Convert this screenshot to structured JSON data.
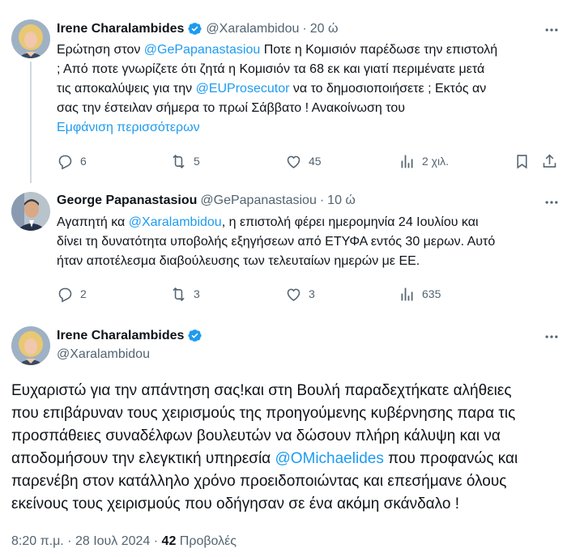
{
  "tweets": [
    {
      "author": "Irene Charalambides",
      "handle": "@Xaralambidou",
      "time": "20 ώ",
      "text_lines": [
        [
          {
            "t": "Ερώτηση στον "
          },
          {
            "t": "@GePapanastasiou",
            "m": true
          },
          {
            "t": " Ποτε η Κομισιόν παρέδωσε την επιστολή"
          }
        ],
        [
          {
            "t": "; Από ποτε γνωρίζετε ότι ζητά η Κομισιόν τα 68 εκ και γιατί περιμένατε μετά"
          }
        ],
        [
          {
            "t": "τις αποκαλύψεις για την "
          },
          {
            "t": "@EUProsecutor",
            "m": true
          },
          {
            "t": " να το δημοσιοποιήσετε ; Εκτός αν"
          }
        ],
        [
          {
            "t": "σας την έστειλαν σήμερα το πρωί Σάββατο ! Ανακοίνωση του"
          }
        ]
      ],
      "show_more": "Εμφάνιση περισσότερων",
      "replies": "6",
      "reposts": "5",
      "likes": "45",
      "views": "2 χιλ."
    },
    {
      "author": "George Papanastasiou",
      "handle": "@GePapanastasiou",
      "time": "10 ώ",
      "text_lines": [
        [
          {
            "t": "Αγαπητή κα "
          },
          {
            "t": "@Xaralambidou",
            "m": true
          },
          {
            "t": ", η επιστολή φέρει ημερομηνία 24 Ιουλίου και"
          }
        ],
        [
          {
            "t": "δίνει τη δυνατότητα υποβολής εξηγήσεων από ΕΤΥΦΑ εντός 30 μερων. Αυτό"
          }
        ],
        [
          {
            "t": "ήταν αποτέλεσμα διαβούλευσης των τελευταίων ημερών με ΕΕ."
          }
        ]
      ],
      "replies": "2",
      "reposts": "3",
      "likes": "3",
      "views": "635"
    }
  ],
  "main": {
    "author": "Irene Charalambides",
    "handle": "@Xaralambidou",
    "text_lines": [
      [
        {
          "t": "Ευχαριστώ για την απάντηση σας!και στη Βουλή παραδεχτήκατε αλήθειες"
        }
      ],
      [
        {
          "t": "που επιβάρυναν τους χειρισμούς της προηγούμενης κυβέρνησης παρα τις"
        }
      ],
      [
        {
          "t": "προσπάθειες συναδέλφων βουλευτών να δώσουν πλήρη κάλυψη και να"
        }
      ],
      [
        {
          "t": "αποδομήσουν την ελεγκτική υπηρεσία "
        },
        {
          "t": "@OMichaelides",
          "m": true
        },
        {
          "t": " που προφανώς και"
        }
      ],
      [
        {
          "t": "παρενέβη στον κατάλληλο χρόνο προειδοποιώντας  και επεσήμανε όλους"
        }
      ],
      [
        {
          "t": "εκείνους τους χειρισμούς που οδήγησαν σε ένα ακόμη σκάνδαλο !"
        }
      ]
    ],
    "timestamp": "8:20 π.μ. · 28 Ιουλ 2024 · ",
    "views_count": "42",
    "views_label": " Προβολές"
  },
  "icons": {
    "reply": "reply-icon",
    "repost": "repost-icon",
    "like": "like-icon",
    "views": "views-icon",
    "bookmark": "bookmark-icon",
    "share": "share-icon",
    "more": "more-icon",
    "verified": "verified-badge-icon"
  },
  "colors": {
    "accent": "#1d9bf0",
    "muted": "#536471",
    "text": "#0f1419",
    "thread_line": "#cfd9de"
  }
}
